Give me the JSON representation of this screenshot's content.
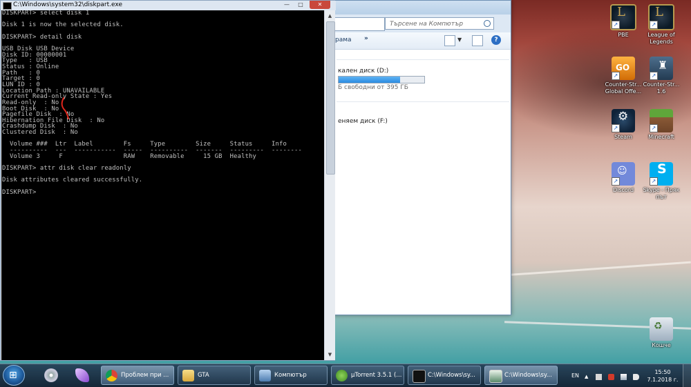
{
  "console": {
    "title": "C:\\Windows\\system32\\diskpart.exe",
    "min_label": "—",
    "max_label": "□",
    "close_label": "✕",
    "lines": [
      "DISKPART> select disk 1",
      "",
      "Disk 1 is now the selected disk.",
      "",
      "DISKPART> detail disk",
      "",
      "USB Disk USB Device",
      "Disk ID: 00000001",
      "Type   : USB",
      "Status : Online",
      "Path   : 0",
      "Target : 0",
      "LUN ID : 0",
      "Location Path : UNAVAILABLE",
      "Current Read-only State : Yes",
      "Read-only  : No",
      "Boot Disk  : No",
      "Pagefile Disk  : No",
      "Hibernation File Disk  : No",
      "Crashdump Disk  : No",
      "Clustered Disk  : No",
      "",
      "  Volume ###  Ltr  Label        Fs     Type        Size     Status     Info",
      "  ----------  ---  -----------  -----  ----------  -------  ---------  --------",
      "  Volume 3     F                RAW    Removable     15 GB  Healthy",
      "",
      "DISKPART> attr disk clear readonly",
      "",
      "Disk attributes cleared successfully.",
      "",
      "DISKPART>"
    ],
    "annotation_color": "#e0261c"
  },
  "explorer": {
    "search_placeholder": "Търсене на Компютър",
    "toolbar_organize": "рама",
    "toolbar_more": "»",
    "help_label": "?",
    "view_caret": "▼",
    "drive_d_label": "кален диск (D:)",
    "drive_d_free": "Б свободни от 395 ГБ",
    "drive_d_fill_fraction": 0.72,
    "drive_f_label": "еняем диск (F:)"
  },
  "desktop": {
    "icons": [
      {
        "name": "pbe",
        "label": "PBE",
        "glyph": "L"
      },
      {
        "name": "league-of-legends",
        "label": "League of Legends",
        "glyph": "L"
      },
      {
        "name": "cs-go",
        "label": "Counter-Str... Global Offe...",
        "glyph": "GO"
      },
      {
        "name": "cs-16",
        "label": "Counter-Str... 1.6",
        "glyph": "♜"
      },
      {
        "name": "steam",
        "label": "Steam",
        "glyph": "⚙"
      },
      {
        "name": "minecraft",
        "label": "Minecraft",
        "glyph": ""
      },
      {
        "name": "discord",
        "label": "Discord",
        "glyph": "☺"
      },
      {
        "name": "skype",
        "label": "Skype - Пряк път",
        "glyph": "S"
      },
      {
        "name": "recycle-bin",
        "label": "Кошче",
        "glyph": "♻"
      }
    ]
  },
  "taskbar": {
    "start_glyph": "⊞",
    "tasks": [
      {
        "name": "chrome",
        "label": "Проблем при ...",
        "color": "#3a9a3a"
      },
      {
        "name": "gta",
        "label": "GTA",
        "color": "#e8c45a"
      },
      {
        "name": "computer",
        "label": "Компютър",
        "color": "#6c8fb8"
      },
      {
        "name": "utorrent",
        "label": "µTorrent 3.5.1 (...",
        "color": "#5aa83a"
      },
      {
        "name": "cmd-1",
        "label": "C:\\Windows\\sy...",
        "color": "#111111"
      },
      {
        "name": "cmd-2",
        "label": "C:\\Windows\\sy...",
        "color": "#2a5a3a"
      }
    ],
    "lang": "EN",
    "time": "15:50",
    "date": "7.1.2018 г."
  }
}
